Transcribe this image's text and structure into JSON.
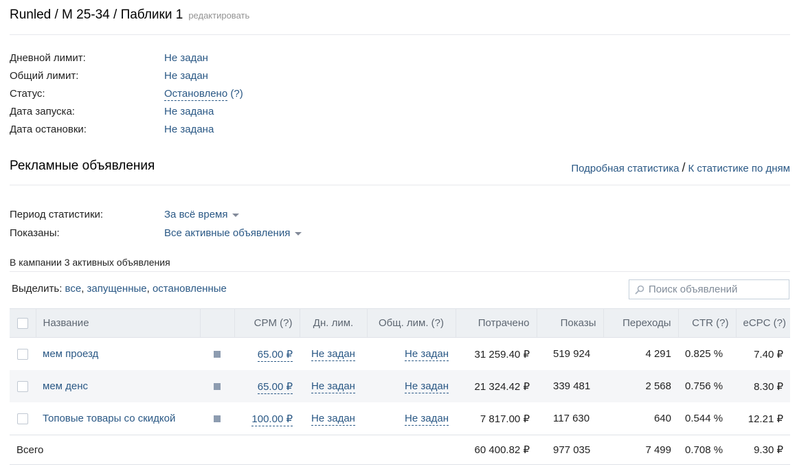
{
  "header": {
    "title": "Runled / M 25-34 / Паблики 1",
    "edit_label": "редактировать"
  },
  "info": {
    "daily_limit_label": "Дневной лимит:",
    "daily_limit_value": "Не задан",
    "total_limit_label": "Общий лимит:",
    "total_limit_value": "Не задан",
    "status_label": "Статус:",
    "status_value": "Остановлено",
    "status_hint": "(?)",
    "start_date_label": "Дата запуска:",
    "start_date_value": "Не задана",
    "stop_date_label": "Дата остановки:",
    "stop_date_value": "Не задана"
  },
  "ads_section": {
    "title": "Рекламные объявления",
    "detailed_stats_link": "Подробная статистика",
    "separator": "/",
    "daily_stats_link": "К статистике по дням",
    "period_label": "Период статистики:",
    "period_value": "За всё время",
    "shown_label": "Показаны:",
    "shown_value": "Все активные объявления",
    "count_text": "В кампании 3 активных объявления",
    "select_label": "Выделить:",
    "select_all": "все",
    "select_running": "запущенные",
    "select_stopped": "остановленные",
    "search_placeholder": "Поиск объявлений"
  },
  "table": {
    "columns": {
      "name": "Название",
      "cpm": "CPM (?)",
      "daily_limit": "Дн. лим.",
      "total_limit": "Общ. лим. (?)",
      "spent": "Потрачено",
      "impressions": "Показы",
      "clicks": "Переходы",
      "ctr": "CTR (?)",
      "ecpc": "eCPC (?)"
    },
    "rows": [
      {
        "name": "мем проезд",
        "cpm": "65.00 ₽",
        "daily_limit": "Не задан",
        "total_limit": "Не задан",
        "spent": "31 259.40 ₽",
        "impressions": "519 924",
        "clicks": "4 291",
        "ctr": "0.825 %",
        "ecpc": "7.40 ₽"
      },
      {
        "name": "мем денс",
        "cpm": "65.00 ₽",
        "daily_limit": "Не задан",
        "total_limit": "Не задан",
        "spent": "21 324.42 ₽",
        "impressions": "339 481",
        "clicks": "2 568",
        "ctr": "0.756 %",
        "ecpc": "8.30 ₽"
      },
      {
        "name": "Топовые товары со скидкой",
        "cpm": "100.00 ₽",
        "daily_limit": "Не задан",
        "total_limit": "Не задан",
        "spent": "7 817.00 ₽",
        "impressions": "117 630",
        "clicks": "640",
        "ctr": "0.544 %",
        "ecpc": "12.21 ₽"
      }
    ],
    "total": {
      "label": "Всего",
      "spent": "60 400.82 ₽",
      "impressions": "977 035",
      "clicks": "7 499",
      "ctr": "0.708 %",
      "ecpc": "9.30 ₽"
    }
  },
  "icons": {
    "search": "search-icon",
    "status": "status-square-icon",
    "dropdown": "caret-down-icon"
  },
  "colors": {
    "link": "#2a5885",
    "header_bg": "#edf0f3",
    "row_shade": "#f5f6f8",
    "status_square": "#8d9cb0"
  }
}
